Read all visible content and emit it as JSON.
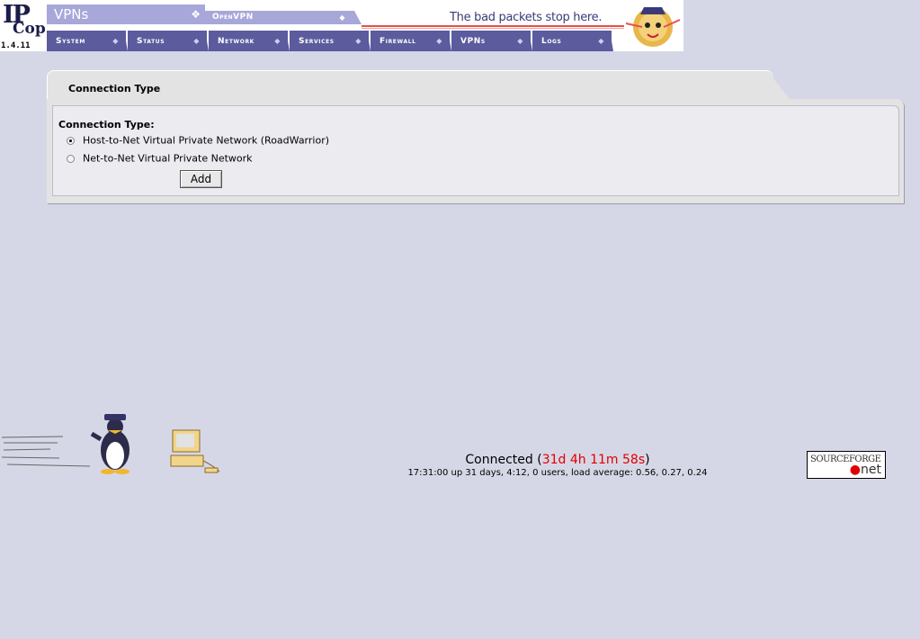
{
  "header": {
    "logo_ip": "IP",
    "logo_cop": "Cop",
    "version": "1.4.11",
    "section_title": "VPNs",
    "subtab": "OpenVPN",
    "slogan": "The bad packets stop here."
  },
  "menu": [
    {
      "label": "System"
    },
    {
      "label": "Status"
    },
    {
      "label": "Network"
    },
    {
      "label": "Services"
    },
    {
      "label": "Firewall"
    },
    {
      "label": "VPNs"
    },
    {
      "label": "Logs"
    }
  ],
  "box": {
    "title": "Connection Type",
    "field_label": "Connection Type:",
    "options": [
      {
        "label": "Host-to-Net Virtual Private Network (RoadWarrior)",
        "selected": true
      },
      {
        "label": "Net-to-Net Virtual Private Network",
        "selected": false
      }
    ],
    "add_label": "Add"
  },
  "footer": {
    "connected_prefix": "Connected (",
    "uptime": "31d 4h 11m 58s",
    "connected_suffix": ")",
    "load_line": "17:31:00 up 31 days, 4:12, 0 users, load average: 0.56, 0.27, 0.24",
    "sf_top": "SOURCEFORGE",
    "sf_net": "net"
  },
  "colors": {
    "background": "#d6d7e6",
    "menu": "#5b5b9e",
    "tab": "#a7a7d9",
    "uptime": "#e00000"
  }
}
